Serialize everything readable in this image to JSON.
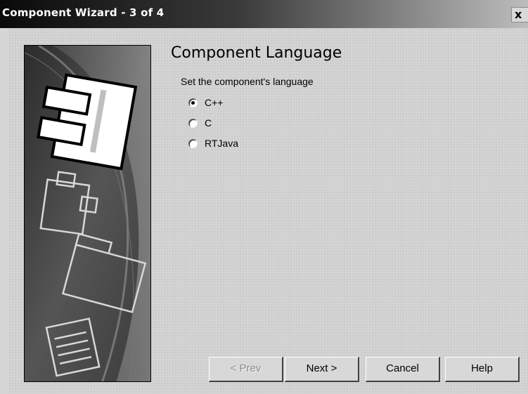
{
  "window": {
    "title": "Component Wizard - 3 of 4",
    "close_label": "x"
  },
  "page": {
    "heading": "Component Language",
    "instruction": "Set the component's language"
  },
  "language_options": [
    {
      "label": "C++",
      "selected": true
    },
    {
      "label": "C",
      "selected": false
    },
    {
      "label": "RTJava",
      "selected": false
    }
  ],
  "buttons": {
    "prev": "< Prev",
    "next": "Next >",
    "cancel": "Cancel",
    "help": "Help"
  },
  "colors": {
    "titlebar_dark": "#0a0a0a",
    "titlebar_light": "#bdbdbd",
    "face": "#d4d4d4",
    "disabled_text": "#8c8c8c"
  }
}
